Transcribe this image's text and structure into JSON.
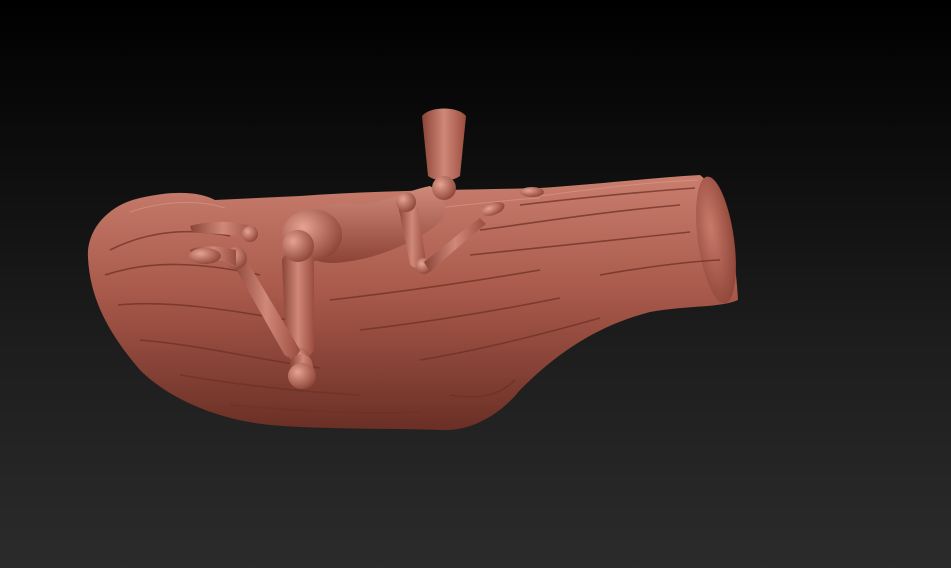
{
  "viewport": {
    "background_top": "#000000",
    "background_bottom": "#2b2b2b"
  },
  "model": {
    "material_color": "#a4574a",
    "material_highlight": "#d58a7a",
    "material_shadow": "#5e2a22",
    "objects": [
      "tree-log",
      "wooden-mannequin"
    ]
  }
}
